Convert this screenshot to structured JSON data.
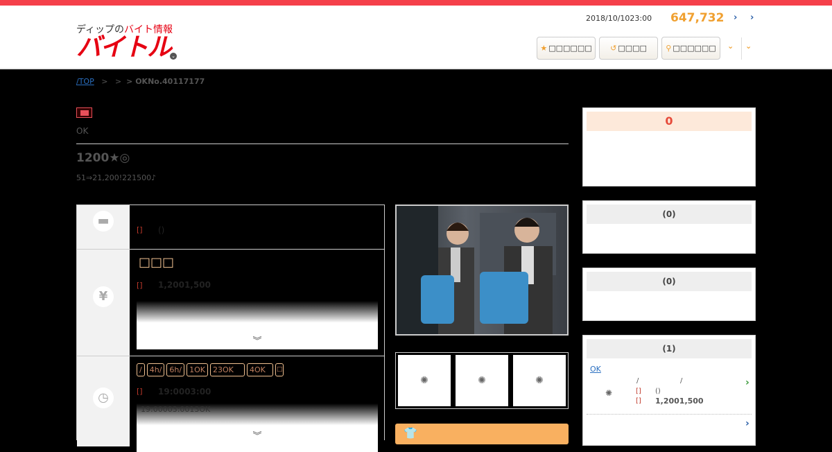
{
  "header": {
    "logo_sub_black": "ディップの",
    "logo_sub_red": "バイト情報",
    "logo_main": "バイトル",
    "date": "2018/10/1023:00",
    "job_count": "647,732",
    "btn_favorites": "□□□□□□",
    "btn_history": "□□□□",
    "btn_search": "□□□□□□"
  },
  "breadcrumb": {
    "top": "/TOP",
    "sep1": ">",
    "sep2": ">",
    "current": "> OKNo.40117177"
  },
  "job": {
    "ok_text": "OK",
    "title": "1200★◎",
    "subtitle": "51⇒21,200!221500♪"
  },
  "table": {
    "row1": {
      "label": "[]",
      "value": "()"
    },
    "row2": {
      "badge": "□□□",
      "label": "[]",
      "value": "1,2001,500"
    },
    "row3": {
      "tags": [
        "/",
        "4h/",
        "6h/",
        "1OK",
        "23OK",
        "4OK",
        "□"
      ],
      "label": "[]",
      "value": "19:0003:00",
      "faded": "19:00003:0013OK"
    }
  },
  "sidebar": {
    "box1_count": "0",
    "box2_title": "(0)",
    "box3_title": "(0)",
    "box4_title": "(1)",
    "box4_link": "OK",
    "box4_slash1": "/",
    "box4_slash2": "/",
    "box4_label1": "[]",
    "box4_value1": "()",
    "box4_label2": "[]",
    "box4_value2": "1,2001,500"
  },
  "colors": {
    "brand": "#f5404a",
    "accent": "#f0a030"
  }
}
